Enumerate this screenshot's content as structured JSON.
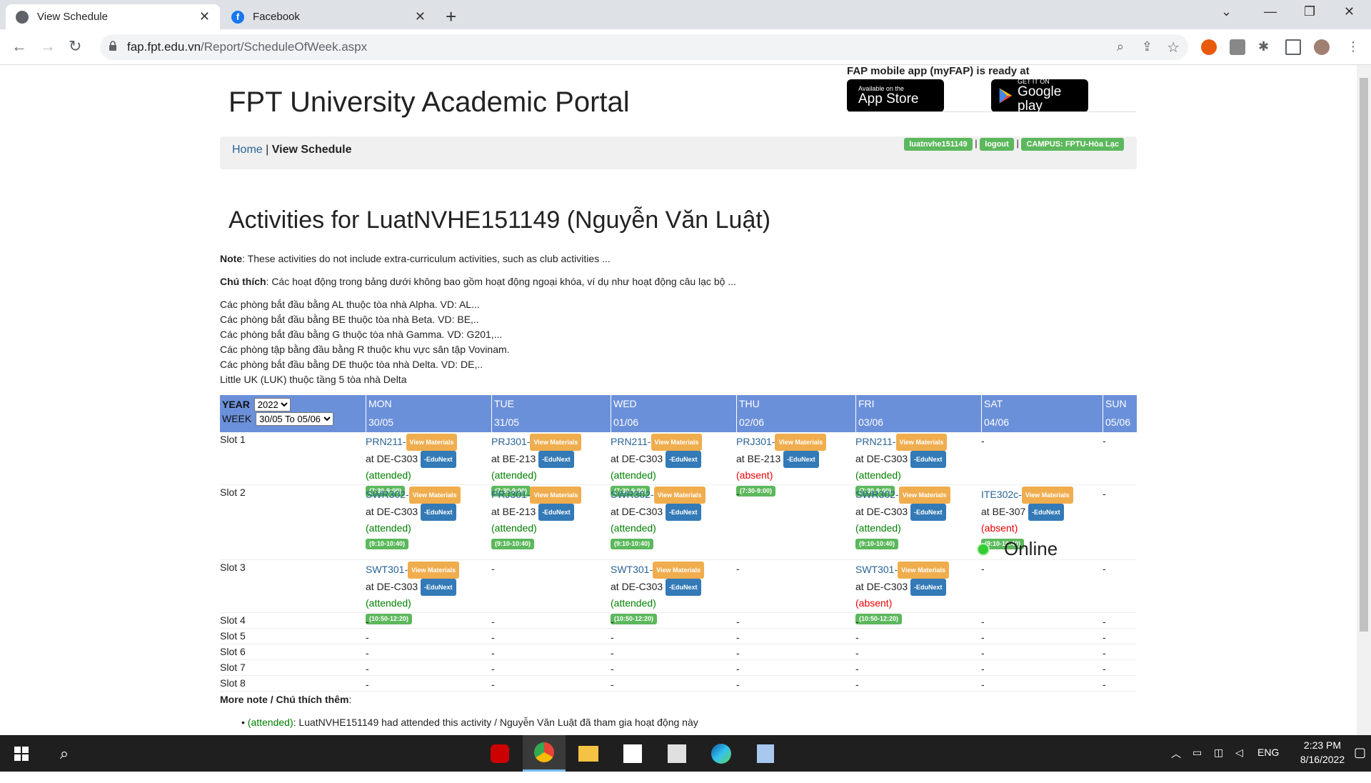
{
  "browser": {
    "tabs": [
      {
        "title": "View Schedule",
        "active": true
      },
      {
        "title": "Facebook",
        "active": false
      }
    ],
    "url_host": "fap.fpt.edu.vn",
    "url_path": "/Report/ScheduleOfWeek.aspx"
  },
  "header": {
    "portal_title": "FPT University Academic Portal",
    "mobile_label": "FAP mobile app (myFAP) is ready at",
    "appstore_small": "Available on the",
    "appstore_big": "App Store",
    "gplay_small": "GET IT ON",
    "gplay_big": "Google play"
  },
  "breadcrumb": {
    "home": "Home",
    "sep": "|",
    "current": "View Schedule",
    "user": "luatnvhe151149",
    "logout": "logout",
    "campus": "CAMPUS: FPTU-Hòa Lạc"
  },
  "main": {
    "heading": "Activities for LuatNVHE151149 (Nguyễn Văn Luật)",
    "note_label": "Note",
    "note_text": ": These activities do not include extra-curriculum activities, such as club activities ...",
    "chuthich_label": "Chú thích",
    "chuthich_text": ": Các hoạt động trong bảng dưới không bao gồm hoạt động ngoại khóa, ví dụ như hoạt động câu lạc bộ ...",
    "rooms": [
      "Các phòng bắt đầu bằng AL thuộc tòa nhà Alpha. VD: AL...",
      "Các phòng bắt đầu bằng BE thuộc tòa nhà Beta. VD: BE,..",
      "Các phòng bắt đầu bằng G thuộc tòa nhà Gamma. VD: G201,...",
      "Các phòng tập bằng đầu bằng R thuộc khu vực sân tập Vovinam.",
      "Các phòng bắt đầu bằng DE thuộc tòa nhà Delta. VD: DE,..",
      "Little UK (LUK) thuộc tầng 5 tòa nhà Delta"
    ]
  },
  "schedule": {
    "year_label": "YEAR",
    "year_value": "2022",
    "week_label": "WEEK",
    "week_value": "30/05 To 05/06",
    "days": [
      "MON",
      "TUE",
      "WED",
      "THU",
      "FRI",
      "SAT",
      "SUN"
    ],
    "dates": [
      "30/05",
      "31/05",
      "01/06",
      "02/06",
      "03/06",
      "04/06",
      "05/06"
    ],
    "view_materials": "View Materials",
    "edunext": "-EduNext",
    "slots": [
      "Slot 1",
      "Slot 2",
      "Slot 3",
      "Slot 4",
      "Slot 5",
      "Slot 6",
      "Slot 7",
      "Slot 8"
    ],
    "dash": "-",
    "online_label": "Online",
    "entries": {
      "s1": [
        {
          "code": "PRN211-",
          "room": "at DE-C303",
          "status": "(attended)",
          "time": "(7:30-9:00)"
        },
        {
          "code": "PRJ301-",
          "room": "at BE-213",
          "status": "(attended)",
          "time": "(7:30-9:00)"
        },
        {
          "code": "PRN211-",
          "room": "at DE-C303",
          "status": "(attended)",
          "time": "(7:30-9:00)"
        },
        {
          "code": "PRJ301-",
          "room": "at BE-213",
          "status": "(absent)",
          "time": "(7:30-9:00)"
        },
        {
          "code": "PRN211-",
          "room": "at DE-C303",
          "status": "(attended)",
          "time": "(7:30-9:00)"
        }
      ],
      "s2": [
        {
          "code": "SWR302-",
          "room": "at DE-C303",
          "status": "(attended)",
          "time": "(9:10-10:40)"
        },
        {
          "code": "PRJ301-",
          "room": "at BE-213",
          "status": "(attended)",
          "time": "(9:10-10:40)"
        },
        {
          "code": "SWR302-",
          "room": "at DE-C303",
          "status": "(attended)",
          "time": "(9:10-10:40)"
        },
        {
          "code": "SWR302-",
          "room": "at DE-C303",
          "status": "(attended)",
          "time": "(9:10-10:40)"
        },
        {
          "code": "ITE302c-",
          "room": "at BE-307",
          "status": "(absent)",
          "time": "(9:10-10:40)"
        }
      ],
      "s3": [
        {
          "code": "SWT301-",
          "room": "at DE-C303",
          "status": "(attended)",
          "time": "(10:50-12:20)"
        },
        {
          "code": "SWT301-",
          "room": "at DE-C303",
          "status": "(attended)",
          "time": "(10:50-12:20)"
        },
        {
          "code": "SWT301-",
          "room": "at DE-C303",
          "status": "(absent)",
          "time": "(10:50-12:20)"
        }
      ]
    }
  },
  "more_note": {
    "label": "More note / Chú thích thêm",
    "colon": ":",
    "item_status": "(attended)",
    "item_text": ": LuatNVHE151149 had attended this activity / Nguyễn Văn Luật đã tham gia hoạt động này"
  },
  "taskbar": {
    "lang": "ENG",
    "time": "2:23 PM",
    "date": "8/16/2022"
  },
  "colors": {
    "header_blue": "#6b90da",
    "green": "#5cb85c",
    "orange": "#f0ad4e",
    "blue_btn": "#337ab7"
  }
}
